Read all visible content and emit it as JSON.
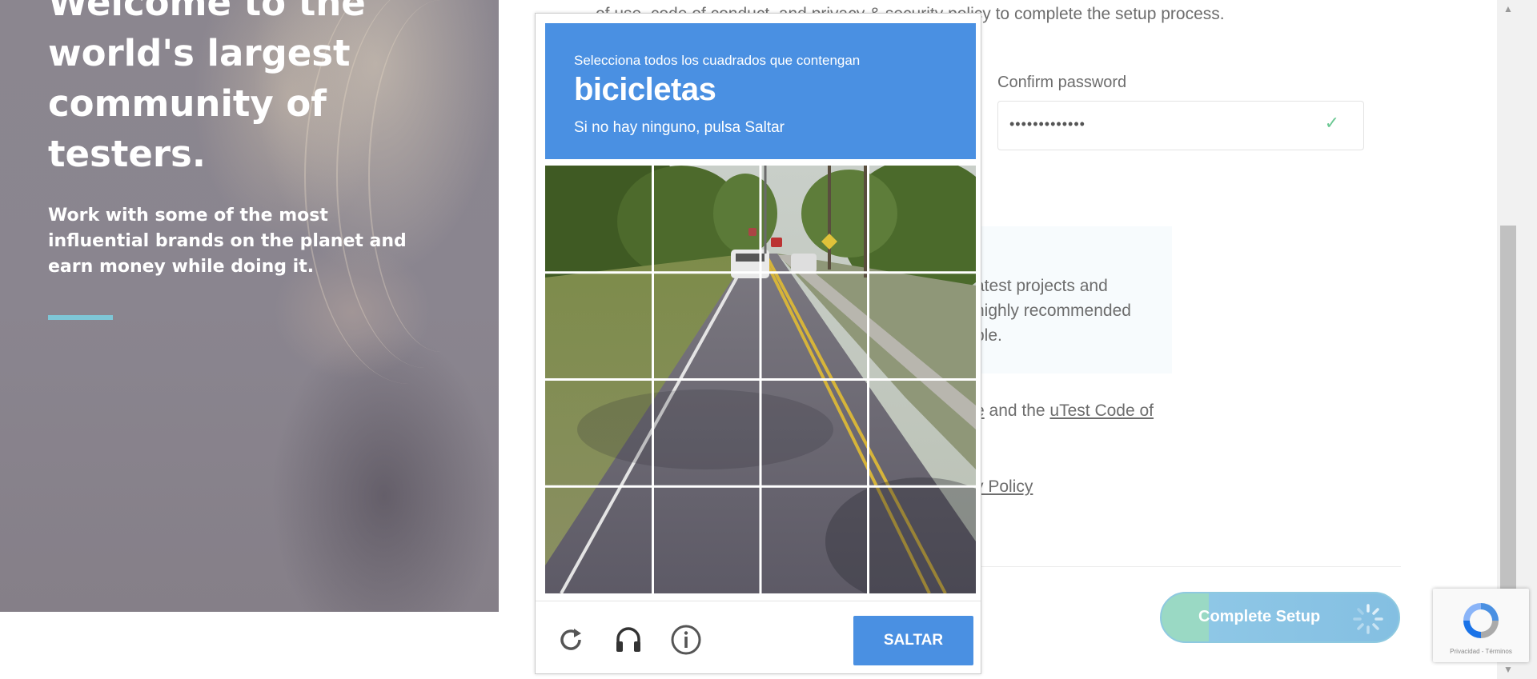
{
  "hero": {
    "title": "Welcome to the world's largest community of testers.",
    "subtitle": "Work with some of the most influential brands on the planet and earn money while doing it."
  },
  "form": {
    "top_text": "of use, code of conduct, and privacy & security policy to complete the setup process.",
    "confirm_password_label": "Confirm password",
    "confirm_password_value": "•••••••••••••",
    "newsletter_lines": [
      "atest projects and",
      "highly recommended",
      "ble."
    ],
    "terms_fragment": "e",
    "terms_and": " and the ",
    "terms_link": "uTest Code of",
    "privacy_link": "y Policy",
    "complete_button": "Complete Setup"
  },
  "captcha": {
    "instruction": "Selecciona todos los cuadrados que contengan",
    "target": "bicicletas",
    "hint": "Si no hay ninguno, pulsa Saltar",
    "grid_rows": 4,
    "grid_cols": 4,
    "skip_button": "SALTAR",
    "icons": [
      "reload-icon",
      "audio-headphones-icon",
      "info-icon"
    ]
  },
  "recaptcha_badge": {
    "terms": "Privacidad - Términos"
  },
  "colors": {
    "captcha_blue": "#4a90e2",
    "accent_teal": "#7ec6d6",
    "check_green": "#6cc893"
  }
}
